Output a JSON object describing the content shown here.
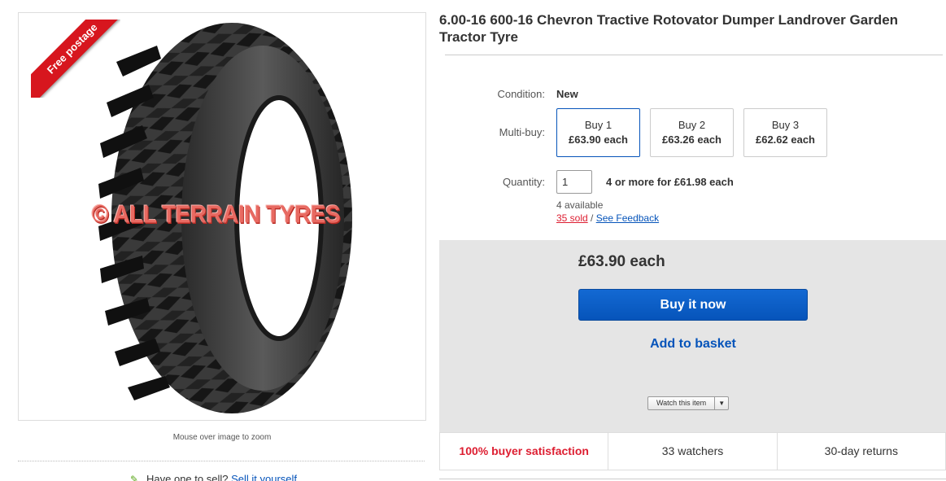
{
  "gallery": {
    "ribbon_text": "Free postage",
    "watermark": "© ALL TERRAIN TYRES",
    "zoom_hint": "Mouse over image to zoom"
  },
  "sell": {
    "prompt": "Have one to sell?",
    "link": "Sell it yourself"
  },
  "listing": {
    "title": "6.00-16 600-16 Chevron Tractive Rotovator Dumper Landrover Garden Tractor Tyre",
    "condition_label": "Condition:",
    "condition_value": "New",
    "multibuy_label": "Multi-buy:",
    "multibuy": [
      {
        "qty": "Buy 1",
        "price": "£63.90 each"
      },
      {
        "qty": "Buy 2",
        "price": "£63.26 each"
      },
      {
        "qty": "Buy 3",
        "price": "£62.62 each"
      }
    ],
    "quantity_label": "Quantity:",
    "quantity_value": "1",
    "quantity_offer": "4 or more for £61.98 each",
    "available": "4 available",
    "sold": "35 sold",
    "sold_separator": " / ",
    "feedback": "See Feedback"
  },
  "purchase": {
    "price": "£63.90 each",
    "buy_now": "Buy it now",
    "add_basket": "Add to basket",
    "watch": "Watch this item",
    "watch_arrow": "▼"
  },
  "stats": {
    "satisfaction": "100% buyer satisfaction",
    "watchers": "33 watchers",
    "returns": "30-day returns"
  },
  "colors": {
    "accent_blue": "#0654ba",
    "ribbon_red": "#d7161e",
    "alert_red": "#dd1e31",
    "panel_gray": "#e5e5e5"
  }
}
